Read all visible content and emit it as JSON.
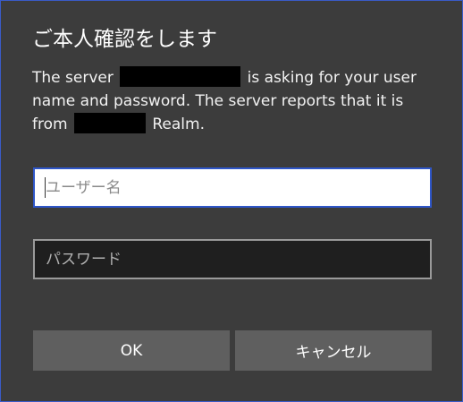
{
  "dialog": {
    "title": "ご本人確認をします",
    "message": {
      "part1": "The server",
      "part2": "is asking for your user name and password. The server reports that it is from",
      "part3": "Realm."
    },
    "username": {
      "placeholder": "ユーザー名",
      "value": ""
    },
    "password": {
      "placeholder": "パスワード",
      "value": ""
    },
    "buttons": {
      "ok_label": "OK",
      "cancel_label": "キャンセル"
    }
  },
  "colors": {
    "background": "#3c3c3c",
    "focus_border": "#2f56c8",
    "button": "#5f5f5f"
  }
}
